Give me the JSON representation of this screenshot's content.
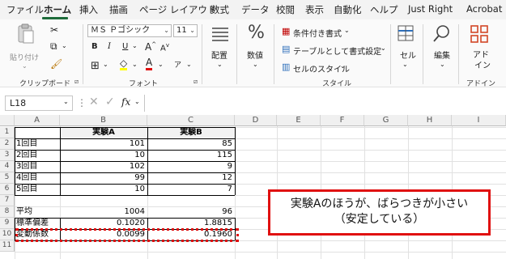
{
  "menu": {
    "tabs": [
      "ファイル",
      "ホーム",
      "挿入",
      "描画",
      "ページ レイアウト",
      "数式",
      "データ",
      "校閲",
      "表示",
      "自動化",
      "ヘルプ",
      "Just Right",
      "Acrobat"
    ],
    "active": "ホーム"
  },
  "ribbon": {
    "clipboard": {
      "paste": "貼り付け",
      "label": "クリップボード"
    },
    "font": {
      "name": "ＭＳ Ｐゴシック",
      "size": "11",
      "label": "フォント"
    },
    "alignment": {
      "label": "配置"
    },
    "number": {
      "label": "数値"
    },
    "styles": {
      "conditional": "条件付き書式",
      "table": "テーブルとして書式設定",
      "cell_styles": "セルのスタイル",
      "label": "スタイル"
    },
    "cells": {
      "label": "セル"
    },
    "editing": {
      "label": "編集"
    },
    "addins": {
      "label_line1": "アド",
      "label_line2": "イン",
      "group": "アドイン"
    }
  },
  "formula_bar": {
    "name_box": "L18",
    "fx": "fx",
    "formula": ""
  },
  "sheet": {
    "columns": [
      "A",
      "B",
      "C",
      "D",
      "E",
      "F",
      "G",
      "H",
      "I"
    ],
    "rows": [
      "1",
      "2",
      "3",
      "4",
      "5",
      "6",
      "7",
      "8",
      "9",
      "10",
      "11"
    ],
    "header_b": "実験A",
    "header_c": "実験B",
    "data_rows": [
      {
        "label": "1回目",
        "a": "101",
        "b": "85"
      },
      {
        "label": "2回目",
        "a": "10",
        "b": "115"
      },
      {
        "label": "3回目",
        "a": "102",
        "b": "9"
      },
      {
        "label": "4回目",
        "a": "99",
        "b": "12"
      },
      {
        "label": "5回目",
        "a": "10",
        "b": "7"
      }
    ],
    "stats": [
      {
        "label": "平均",
        "a": "1004",
        "b": "96"
      },
      {
        "label": "標準偏差",
        "a": "0.1020",
        "b": "1.8815"
      },
      {
        "label": "変動係数",
        "a": "0.0099",
        "b": "0.1960"
      }
    ]
  },
  "callout": {
    "line1": "実験Aのほうが、ばらつきが小さい",
    "line2": "（安定している）",
    "border_color": "#e01010"
  },
  "highlight_color": "#e01010"
}
